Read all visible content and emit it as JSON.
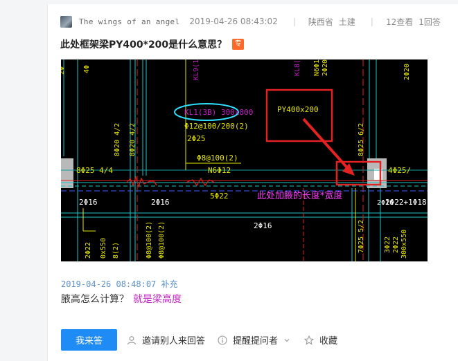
{
  "question": {
    "author": "The wings of an angel",
    "posted_time": "2019-04-26 08:43:02",
    "separator": "|",
    "province": "陕西省",
    "category": "土建",
    "views": "12查看",
    "answers": "1回答",
    "title": "此处框架梁PY400*200是什么意思？",
    "tag": "专"
  },
  "cad_image": {
    "texts": [
      "KL1(3B) 300x800",
      "PY400x200",
      "Φ12@100/200(2)",
      "2Φ25",
      "Φ8@100(2)",
      "N6Φ12",
      "8Φ25 4/4",
      "8Φ25 6/2",
      "4Φ25/",
      "5Φ22",
      "2Φ16",
      "2Φ16",
      "2Φ16",
      "2Φ16",
      "2Φ22+1Φ18",
      "此处加腋的长度*宽度",
      "7Φ25 5/2",
      "3Φ22",
      "300x550",
      "2Φ22",
      "2Φ22",
      "2Φ20",
      "Φ8@100(2)",
      "8Φ20 4/2",
      "KL9(1)",
      "KL8(1)",
      "N6Φ1",
      "2Φ20",
      "4Φ",
      "2Φ",
      "Φ8@100(2)",
      "8Φ20 4/2",
      "0x550",
      "8(2)"
    ]
  },
  "supplement": {
    "time": "2019-04-26 08:48:07 补充",
    "text": "腋高怎么计算？",
    "highlight": "就是梁高度"
  },
  "actions": {
    "answer": "我来答",
    "invite": "邀请别人来回答",
    "remind": "提醒提问者",
    "favorite": "收藏"
  },
  "colors": {
    "primary": "#1f8bf5",
    "tag": "#ff6a2b",
    "highlight": "#c020c0"
  }
}
